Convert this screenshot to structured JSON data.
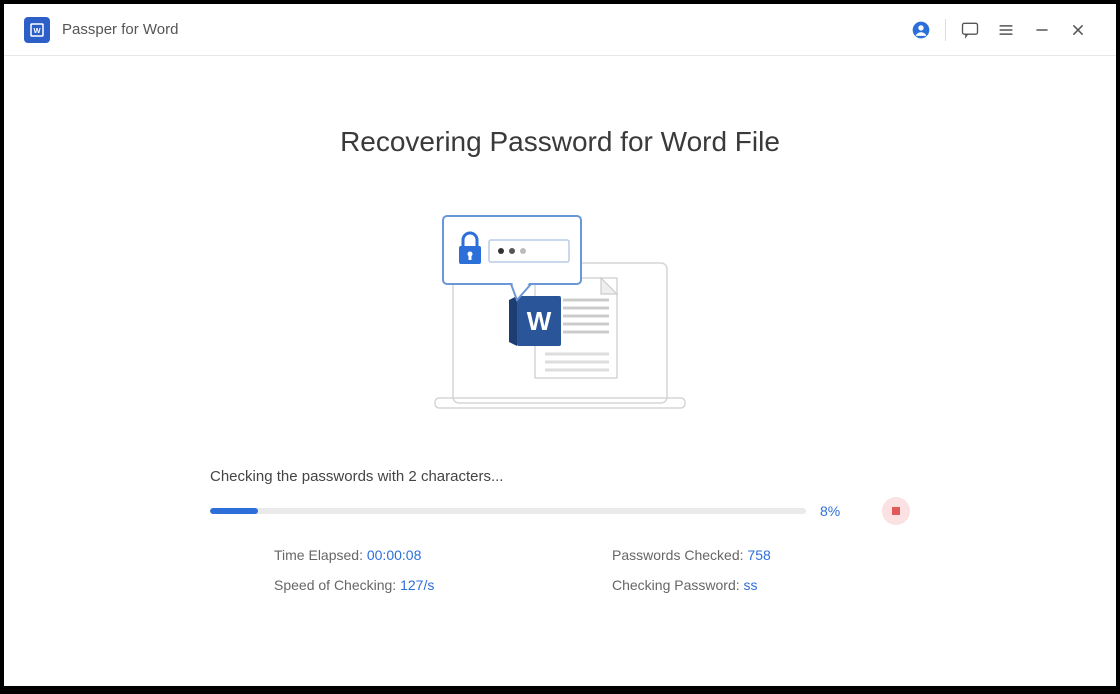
{
  "app": {
    "title": "Passper for Word"
  },
  "main": {
    "heading": "Recovering Password for Word File",
    "status": "Checking the passwords with 2 characters...",
    "progress_percent": "8%",
    "progress_width": "8%"
  },
  "stats": {
    "time_elapsed_label": "Time Elapsed: ",
    "time_elapsed_value": "00:00:08",
    "passwords_checked_label": "Passwords Checked: ",
    "passwords_checked_value": "758",
    "speed_label": "Speed of Checking: ",
    "speed_value": "127/s",
    "checking_password_label": "Checking Password: ",
    "checking_password_value": "ss"
  },
  "colors": {
    "accent": "#2d6fd9",
    "stop_bg": "#fbe1e1",
    "stop_fg": "#e05a5a"
  },
  "icons": {
    "user": "user-icon",
    "feedback": "feedback-icon",
    "menu": "menu-icon",
    "minimize": "minimize-icon",
    "close": "close-icon",
    "stop": "stop-icon",
    "lock": "lock-icon",
    "word": "word-icon"
  }
}
